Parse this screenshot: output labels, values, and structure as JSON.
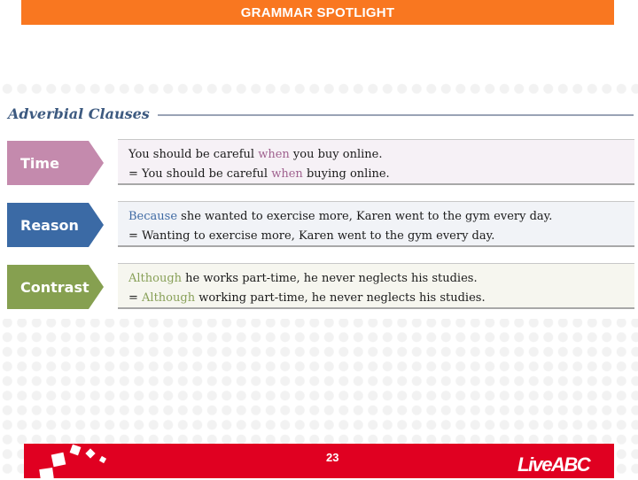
{
  "header": {
    "banner_title": "GRAMMAR SPOTLIGHT",
    "banner_color": "#f97720"
  },
  "section": {
    "title": "Adverbial Clauses"
  },
  "rows": [
    {
      "tag": "Time",
      "tag_color": "#c48aad",
      "box_color": "#f6f1f6",
      "keyword_color": "#a0628f",
      "line1": {
        "pre": "",
        "kw": "",
        "pre_plain": "You should be careful ",
        "keyword": "when",
        "post": " you buy online."
      },
      "line2": {
        "pre_plain": "= You should be careful ",
        "keyword": "when",
        "post": " buying online."
      }
    },
    {
      "tag": "Reason",
      "tag_color": "#3b6aa5",
      "box_color": "#f1f3f7",
      "keyword_color": "#3f6aa3",
      "line1": {
        "pre_plain": "",
        "keyword": "Because",
        "post": " she wanted to exercise more, Karen went to the gym every day."
      },
      "line2": {
        "pre_plain": "= Wanting to exercise more, Karen went to the gym every day.",
        "keyword": "",
        "post": ""
      }
    },
    {
      "tag": "Contrast",
      "tag_color": "#86a050",
      "box_color": "#f6f6ef",
      "keyword_color": "#88a058",
      "line1": {
        "pre_plain": "",
        "keyword": "Although",
        "post": " he works part-time, he never neglects his studies."
      },
      "line2": {
        "pre_plain": "= ",
        "keyword": "Although",
        "post": " working part-time, he never neglects his studies."
      }
    }
  ],
  "footer": {
    "page_number": "23",
    "logo_text": "LiveABC",
    "footer_color": "#e00021"
  }
}
